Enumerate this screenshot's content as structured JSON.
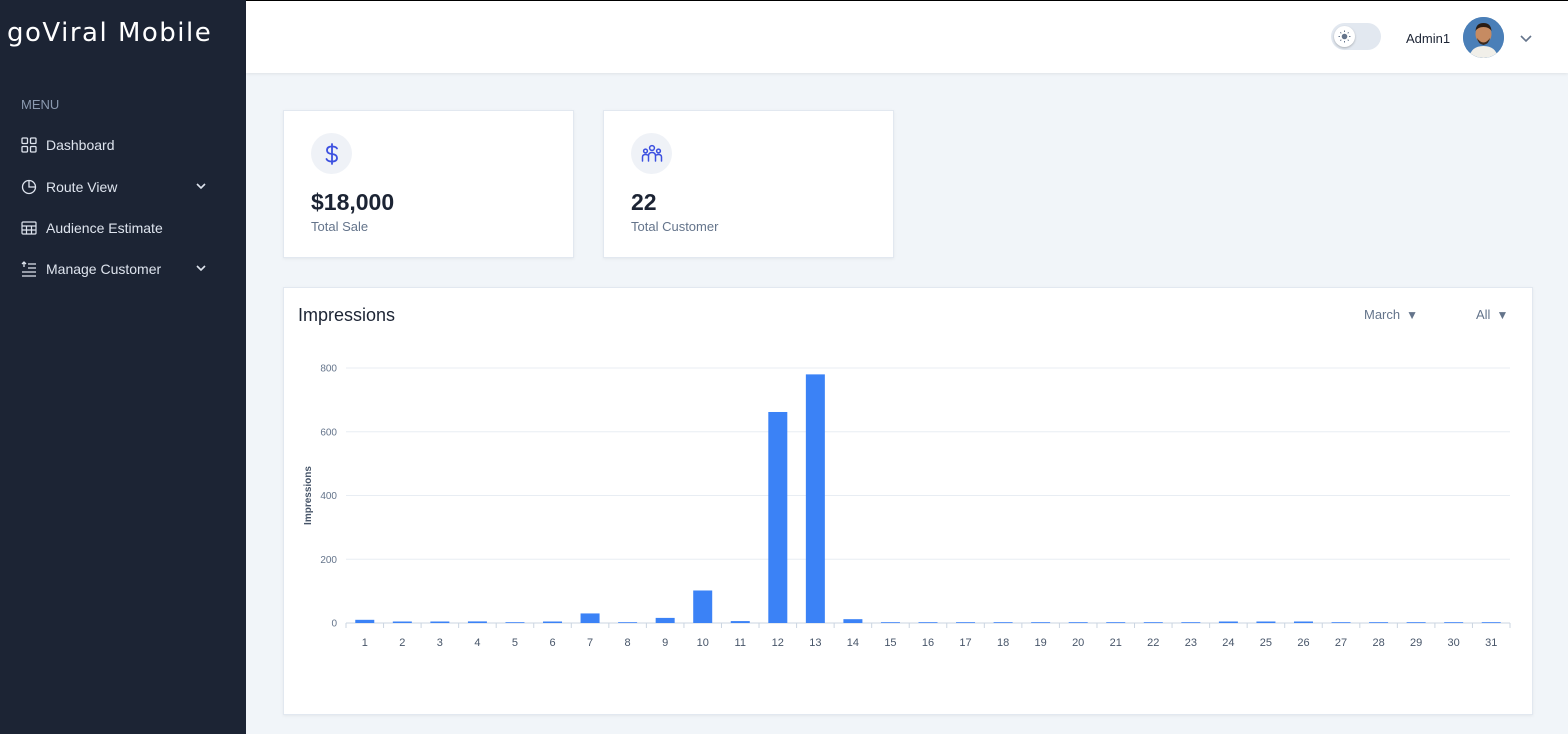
{
  "app": {
    "logo": "goViral Mobile"
  },
  "sidebar": {
    "menu_title": "MENU",
    "items": [
      {
        "label": "Dashboard",
        "icon": "grid-icon"
      },
      {
        "label": "Route View",
        "icon": "pie-chart-icon",
        "has_submenu": true
      },
      {
        "label": "Audience Estimate",
        "icon": "table-icon"
      },
      {
        "label": "Manage Customer",
        "icon": "list-icon",
        "has_submenu": true
      }
    ]
  },
  "header": {
    "user_name": "Admin1",
    "theme_toggle": "light"
  },
  "stats": [
    {
      "value": "$18,000",
      "label": "Total Sale",
      "icon": "dollar-icon"
    },
    {
      "value": "22",
      "label": "Total Customer",
      "icon": "users-icon"
    }
  ],
  "impressions": {
    "title": "Impressions",
    "month_filter": "March",
    "scope_filter": "All"
  },
  "colors": {
    "sidebar": "#1c2434",
    "bar": "#3b82f6",
    "accent": "#3c50e0"
  },
  "chart_data": {
    "type": "bar",
    "categories": [
      "1",
      "2",
      "3",
      "4",
      "5",
      "6",
      "7",
      "8",
      "9",
      "10",
      "11",
      "12",
      "13",
      "14",
      "15",
      "16",
      "17",
      "18",
      "19",
      "20",
      "21",
      "22",
      "23",
      "24",
      "25",
      "26",
      "27",
      "28",
      "29",
      "30",
      "31"
    ],
    "values": [
      10,
      2,
      2,
      5,
      0,
      3,
      30,
      0,
      16,
      102,
      6,
      662,
      780,
      12,
      0,
      0,
      0,
      0,
      0,
      0,
      0,
      0,
      0,
      4,
      2,
      2,
      0,
      0,
      0,
      0,
      0
    ],
    "ylabel": "Impressions",
    "yticks": [
      "0",
      "200",
      "400",
      "600",
      "800"
    ],
    "ylim": [
      0,
      800
    ],
    "grid": true,
    "legend": false
  }
}
